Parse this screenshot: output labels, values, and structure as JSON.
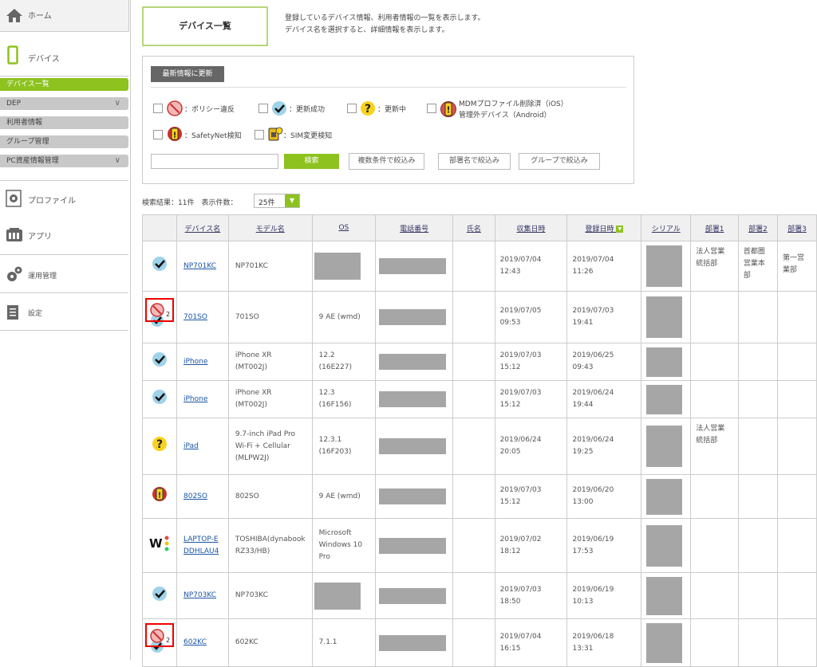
{
  "nav": {
    "home": "ホーム",
    "device": "デバイス",
    "sub_items": [
      "デバイス一覧",
      "DEP",
      "利用者情報",
      "グループ管理",
      "PC資産情報管理"
    ],
    "profile": "プロファイル",
    "app": "アプリ",
    "admin": "運用管理",
    "settings": "設定"
  },
  "page": {
    "title": "デバイス一覧",
    "desc1": "登録しているデバイス情報、利用者情報の一覧を表示します。",
    "desc2": "デバイス名を選択すると、詳細情報を表示します。"
  },
  "panel": {
    "refresh": "最新情報に更新",
    "legend": {
      "policy": "：ポリシー違反",
      "success": "：更新成功",
      "updating": "：更新中",
      "mdm1": "MDMプロファイル削除済（iOS）",
      "mdm2": "管理外デバイス（Android）",
      "safetynet": "：SafetyNet検知",
      "sim": "：SIM変更検知"
    },
    "search_value": "",
    "search": "検索",
    "multi": "複数条件で絞込み",
    "dept": "部署名で絞込み",
    "group": "グループで絞込み"
  },
  "result": {
    "label": "検索結果：11件　表示件数：",
    "per_page": "25件"
  },
  "table": {
    "headers": [
      "デバイス名",
      "モデル名",
      "OS",
      "電話番号",
      "氏名",
      "収集日時",
      "登録日時",
      "シリアル",
      "部署1",
      "部署2",
      "部署3"
    ],
    "rows": [
      {
        "status": "success",
        "name1": "NP701KC",
        "name2": "",
        "model": "NP701KC",
        "os": "",
        "phone": "",
        "collect1": "2019/07/04",
        "collect2": "12:43",
        "reg1": "2019/07/04",
        "reg2": "11:26",
        "d1": "法人営業統括部",
        "d2": "首都圏営業本部",
        "d3": "第一営業部"
      },
      {
        "status": "policy",
        "name1": "701SO",
        "name2": "",
        "model": "701SO",
        "os": "9 AE (wmd)",
        "phone": "",
        "collect1": "2019/07/05",
        "collect2": "09:53",
        "reg1": "2019/07/03",
        "reg2": "19:41",
        "d1": "",
        "d2": "",
        "d3": ""
      },
      {
        "status": "success",
        "name1": "iPhone",
        "name2": "",
        "model": "iPhone XR (MT002J)",
        "os": "12.2 (16E227)",
        "phone": "",
        "collect1": "2019/07/03",
        "collect2": "15:12",
        "reg1": "2019/06/25",
        "reg2": "09:43",
        "d1": "",
        "d2": "",
        "d3": ""
      },
      {
        "status": "success",
        "name1": "iPhone",
        "name2": "",
        "model": "iPhone XR (MT002J)",
        "os": "12.3 (16F156)",
        "phone": "",
        "collect1": "2019/07/03",
        "collect2": "15:12",
        "reg1": "2019/06/24",
        "reg2": "19:44",
        "d1": "",
        "d2": "",
        "d3": ""
      },
      {
        "status": "updating",
        "name1": "iPad",
        "name2": "",
        "model": "9.7-inch iPad Pro Wi-Fi + Cellular (MLPW2J)",
        "os": "12.3.1 (16F203)",
        "phone": "",
        "collect1": "2019/06/24",
        "collect2": "20:05",
        "reg1": "2019/06/24",
        "reg2": "19:25",
        "d1": "法人営業統括部",
        "d2": "",
        "d3": ""
      },
      {
        "status": "safetynet",
        "name1": "802SO",
        "name2": "",
        "model": "802SO",
        "os": "9 AE (wmd)",
        "phone": "",
        "collect1": "2019/07/03",
        "collect2": "15:12",
        "reg1": "2019/06/20",
        "reg2": "13:00",
        "d1": "",
        "d2": "",
        "d3": ""
      },
      {
        "status": "windows",
        "name1": "LAPTOP-E",
        "name2": "DDHLAU4",
        "model": "TOSHIBA(dynabook RZ33/HB)",
        "os": "Microsoft Windows 10 Pro",
        "phone": "",
        "collect1": "2019/07/02",
        "collect2": "18:12",
        "reg1": "2019/06/19",
        "reg2": "17:53",
        "d1": "",
        "d2": "",
        "d3": ""
      },
      {
        "status": "success",
        "name1": "NP703KC",
        "name2": "",
        "model": "NP703KC",
        "os": "",
        "phone": "",
        "collect1": "2019/07/03",
        "collect2": "18:50",
        "reg1": "2019/06/19",
        "reg2": "10:13",
        "d1": "",
        "d2": "",
        "d3": ""
      },
      {
        "status": "policy",
        "name1": "602KC",
        "name2": "",
        "model": "602KC",
        "os": "7.1.1",
        "phone": "",
        "collect1": "2019/07/04",
        "collect2": "16:15",
        "reg1": "2019/06/18",
        "reg2": "13:31",
        "d1": "",
        "d2": "",
        "d3": ""
      }
    ]
  },
  "colors": {
    "accent": "#8dc21f",
    "link": "#1a55a6",
    "highlight": "#ee0000",
    "mask": "#a6a6a6"
  }
}
